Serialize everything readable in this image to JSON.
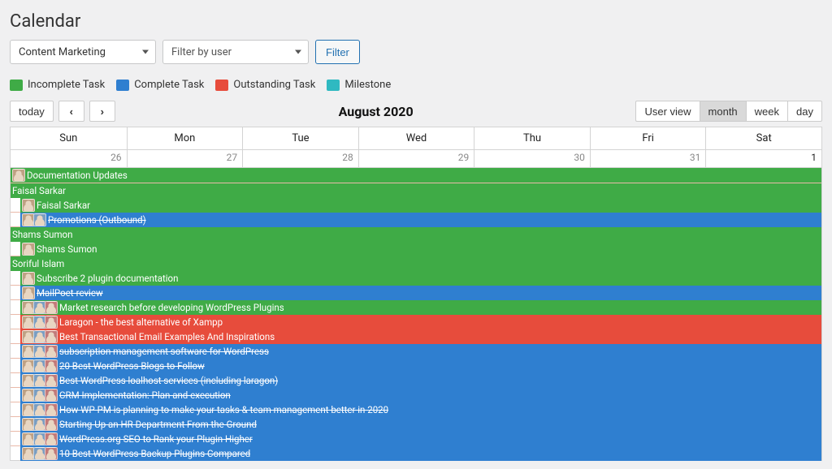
{
  "page_title": "Calendar",
  "filters": {
    "category_value": "Content Marketing",
    "user_placeholder": "Filter by user",
    "filter_button": "Filter"
  },
  "legend": {
    "incomplete": {
      "label": "Incomplete Task",
      "color": "#3fab46"
    },
    "complete": {
      "label": "Complete Task",
      "color": "#2f7fd0"
    },
    "outstanding": {
      "label": "Outstanding Task",
      "color": "#e74c3c"
    },
    "milestone": {
      "label": "Milestone",
      "color": "#2fb9c1"
    }
  },
  "toolbar": {
    "today": "today",
    "prev": "‹",
    "next": "›",
    "title": "August 2020",
    "views": {
      "user": "User view",
      "month": "month",
      "week": "week",
      "day": "day"
    }
  },
  "dow": [
    "Sun",
    "Mon",
    "Tue",
    "Wed",
    "Thu",
    "Fri",
    "Sat"
  ],
  "dates": [
    {
      "n": "26",
      "cur": false
    },
    {
      "n": "27",
      "cur": false
    },
    {
      "n": "28",
      "cur": false
    },
    {
      "n": "29",
      "cur": false
    },
    {
      "n": "30",
      "cur": false
    },
    {
      "n": "31",
      "cur": false
    },
    {
      "n": "1",
      "cur": true
    }
  ],
  "events": [
    {
      "label": "Documentation Updates",
      "status": "incomplete",
      "avatars": 1,
      "strike": false,
      "indented": false
    },
    {
      "label": "Faisal Sarkar",
      "status": "incomplete",
      "avatars": 0,
      "strike": false,
      "indented": false
    },
    {
      "label": "Faisal Sarkar",
      "status": "incomplete",
      "avatars": 1,
      "strike": false,
      "indented": true
    },
    {
      "label": "Promotions (Outbound)",
      "status": "complete",
      "avatars": 2,
      "strike": true,
      "indented": true
    },
    {
      "label": "Shams Sumon",
      "status": "incomplete",
      "avatars": 0,
      "strike": false,
      "indented": false
    },
    {
      "label": "Shams Sumon",
      "status": "incomplete",
      "avatars": 1,
      "strike": false,
      "indented": true
    },
    {
      "label": "Soriful Islam",
      "status": "incomplete",
      "avatars": 0,
      "strike": false,
      "indented": false
    },
    {
      "label": "Subscribe 2 plugin documentation",
      "status": "incomplete",
      "avatars": 1,
      "strike": false,
      "indented": true
    },
    {
      "label": "MailPoet-review",
      "status": "complete",
      "avatars": 1,
      "strike": true,
      "indented": true
    },
    {
      "label": "Market research before developing WordPress Plugins",
      "status": "incomplete",
      "avatars": 3,
      "strike": false,
      "indented": true
    },
    {
      "label": "Laragon - the best alternative of Xampp",
      "status": "outstanding",
      "avatars": 3,
      "strike": false,
      "indented": true
    },
    {
      "label": "Best Transactional Email Examples And Inspirations",
      "status": "outstanding",
      "avatars": 3,
      "strike": false,
      "indented": true
    },
    {
      "label": "subscription management software for WordPress",
      "status": "complete",
      "avatars": 3,
      "strike": true,
      "indented": true
    },
    {
      "label": "20 Best WordPress Blogs to Follow",
      "status": "complete",
      "avatars": 3,
      "strike": true,
      "indented": true
    },
    {
      "label": "Best WordPress loalhost services (including laragon)",
      "status": "complete",
      "avatars": 3,
      "strike": true,
      "indented": true
    },
    {
      "label": "CRM Implementation: Plan and execution",
      "status": "complete",
      "avatars": 3,
      "strike": true,
      "indented": true
    },
    {
      "label": "How WP PM is planning to make your tasks & team management better in 2020",
      "status": "complete",
      "avatars": 3,
      "strike": true,
      "indented": true
    },
    {
      "label": "Starting Up an HR Department From the Ground",
      "status": "complete",
      "avatars": 3,
      "strike": true,
      "indented": true
    },
    {
      "label": "WordPress.org SEO to Rank your Plugin Higher",
      "status": "complete",
      "avatars": 3,
      "strike": true,
      "indented": true
    },
    {
      "label": "10 Best WordPress Backup Plugins Compared",
      "status": "complete",
      "avatars": 3,
      "strike": true,
      "indented": true
    }
  ]
}
